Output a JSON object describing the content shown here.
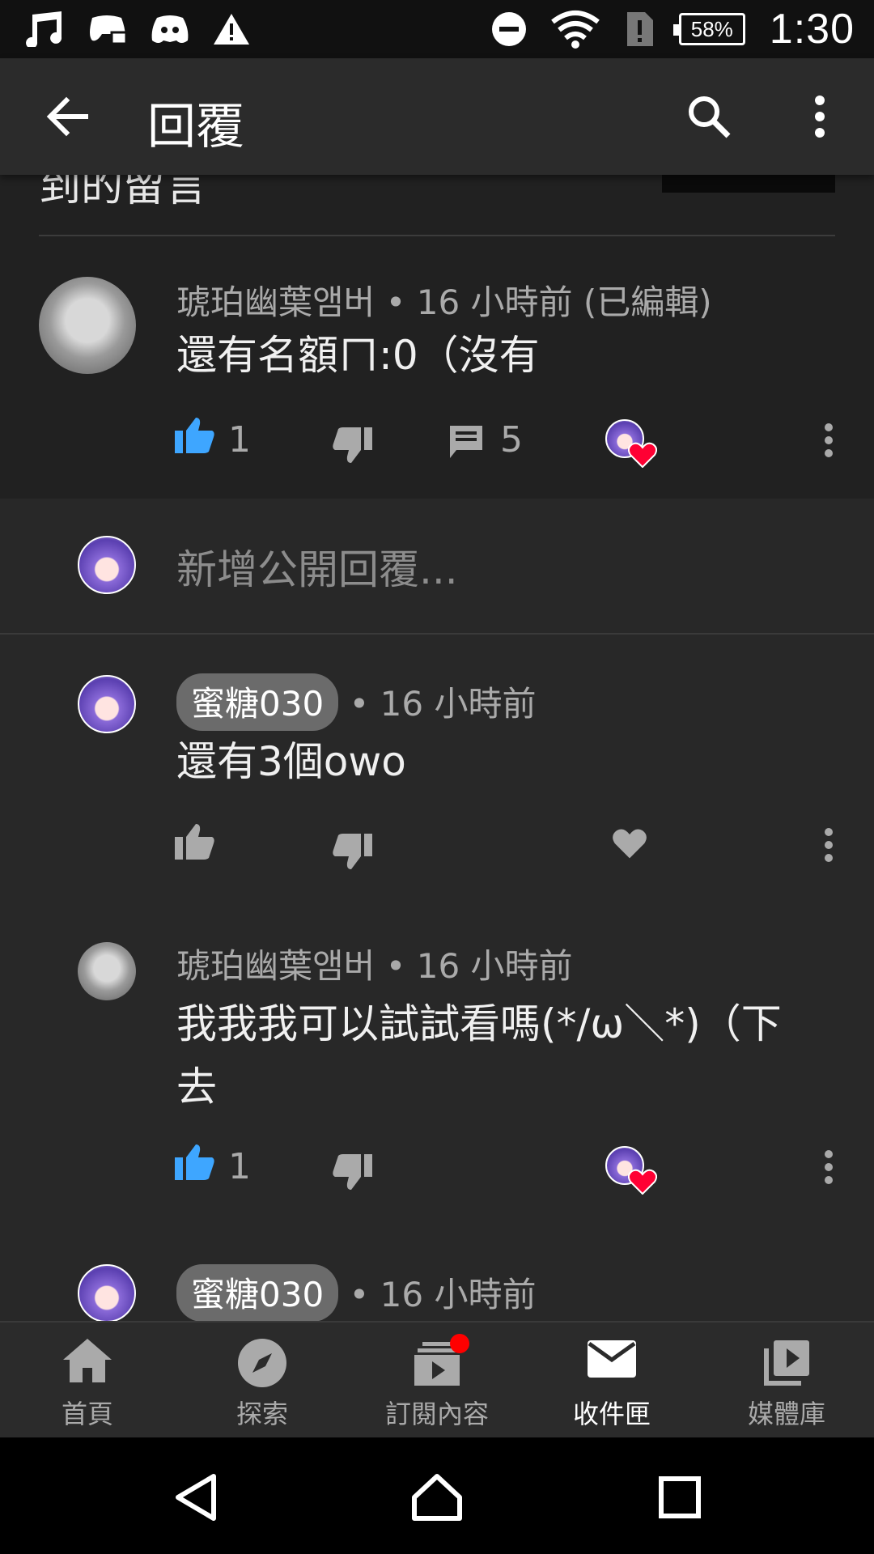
{
  "status_bar": {
    "time": "1:30",
    "battery": "58%"
  },
  "app_bar": {
    "title": "回覆"
  },
  "previous": {
    "text": "到的留言"
  },
  "comments": [
    {
      "author": "琥珀幽葉앰버",
      "time": "• 16 小時前 (已編輯)",
      "text": "還有名額ㄇ:0（沒有",
      "likes": "1",
      "replies": "5",
      "liked": true,
      "creator_heart": true
    },
    {
      "author": "蜜糖030",
      "time": "• 16 小時前",
      "text": "還有3個owo",
      "likes": "",
      "liked": false,
      "creator_heart": false
    },
    {
      "author": "琥珀幽葉앰버",
      "time": "• 16 小時前",
      "text_line1": "我我我可以試試看嗎(*/ω＼*)（下",
      "text_line2": "去",
      "likes": "1",
      "liked": true,
      "creator_heart": true
    },
    {
      "author": "蜜糖030",
      "time": "• 16 小時前"
    }
  ],
  "reply_box": {
    "placeholder": "新增公開回覆..."
  },
  "bottom_nav": [
    {
      "label": "首頁",
      "icon": "home-icon"
    },
    {
      "label": "探索",
      "icon": "explore-icon"
    },
    {
      "label": "訂閱內容",
      "icon": "subscriptions-icon"
    },
    {
      "label": "收件匣",
      "icon": "inbox-icon",
      "active": true
    },
    {
      "label": "媒體庫",
      "icon": "library-icon"
    }
  ],
  "colors": {
    "accent_like": "#3ea6ff",
    "heart": "#ff0033",
    "notification": "#ff0000"
  }
}
